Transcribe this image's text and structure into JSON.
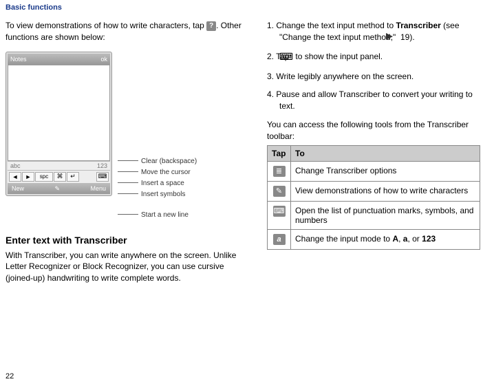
{
  "header": "Basic functions",
  "page_number": "22",
  "left": {
    "intro_before": "To view demonstrations of how to write characters, tap ",
    "intro_after": ". Other functions are shown below:",
    "device": {
      "title": "Notes",
      "ok": "ok",
      "mode_left": "abc",
      "mode_right": "123",
      "arrow_left": "◄",
      "arrow_right": "►",
      "spc": "spc",
      "sym": "⌘",
      "ret": "↵",
      "kbd": "⌨",
      "bottom_left": "New",
      "bottom_mid": "✎",
      "bottom_right": "Menu"
    },
    "annotations": {
      "a1": "Clear (backspace)",
      "a2": "Move the cursor",
      "a3": "Insert a space",
      "a4": "Insert symbols",
      "a5": "Start a new line"
    },
    "subhead": "Enter text with Transcriber",
    "body": "With Transcriber, you can write anywhere on the screen. Unlike Letter Recognizer or Block Recognizer, you can use cursive (joined-up) handwriting to write complete words."
  },
  "right": {
    "step1_before": "1. Change the text input method to ",
    "step1_bold": "Transcriber",
    "step1_after": " (see \"Change the text input method,\" ",
    "step1_ref": " 19).",
    "step2_before": "2. Tap ",
    "step2_after": " to show the input panel.",
    "step3": "3. Write legibly anywhere on the screen.",
    "step4": "4. Pause and allow Transcriber to convert your writing to text.",
    "tools_intro": "You can access the following tools from the Transcriber toolbar:",
    "table": {
      "th1": "Tap",
      "th2": "To",
      "r1": "Change Transcriber options",
      "r2": "View demonstrations of how to write characters",
      "r3": "Open the list of punctuation marks, symbols, and numbers",
      "r4_before": "Change the input mode to ",
      "r4_b1": "A",
      "r4_mid1": ", ",
      "r4_b2": "a",
      "r4_mid2": ", or ",
      "r4_b3": "123",
      "icon1": "≣",
      "icon2": "✎",
      "icon3": "⌨",
      "icon4": "a"
    }
  }
}
